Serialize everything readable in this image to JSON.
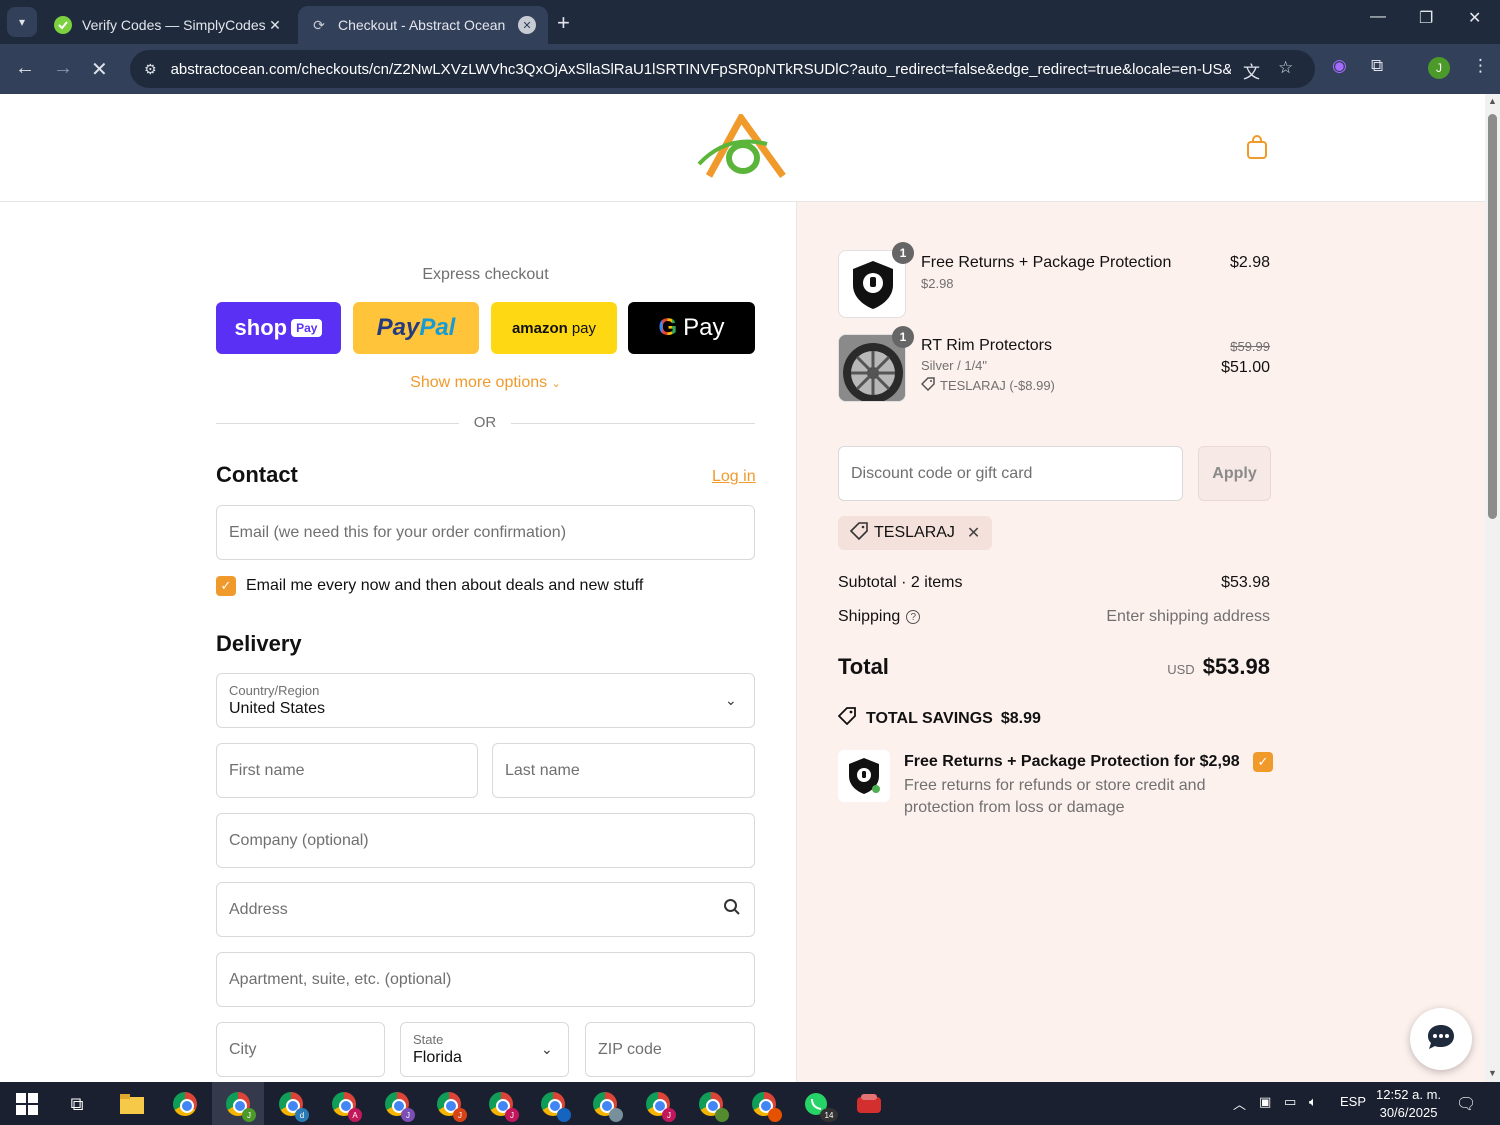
{
  "browser": {
    "tabs": [
      {
        "title": "Verify Codes — SimplyCodes",
        "active": false
      },
      {
        "title": "Checkout - Abstract Ocean",
        "active": true
      }
    ],
    "url": "abstractocean.com/checkouts/cn/Z2NwLXVzLWVhc3QxOjAxSllaSlRaU1lSRTINVFpSR0pNTkRSUDlC?auto_redirect=false&edge_redirect=true&locale=en-US&ski...",
    "profile_initial": "J"
  },
  "checkout": {
    "express_title": "Express checkout",
    "shop_pay": {
      "shop": "shop",
      "pay": "Pay"
    },
    "paypal": {
      "pay": "Pay",
      "pal": "Pal"
    },
    "amazon": {
      "amazon": "amazon",
      "pay": "pay"
    },
    "gpay": {
      "g": "G",
      "pay": "Pay"
    },
    "show_more": "Show more options",
    "or": "OR",
    "contact": {
      "title": "Contact",
      "login": "Log in",
      "email_placeholder": "Email (we need this for your order confirmation)",
      "newsletter_label": "Email me every now and then about deals and new stuff",
      "newsletter_checked": true
    },
    "delivery": {
      "title": "Delivery",
      "country_label": "Country/Region",
      "country_value": "United States",
      "first_name": "First name",
      "last_name": "Last name",
      "company": "Company (optional)",
      "address": "Address",
      "apartment": "Apartment, suite, etc. (optional)",
      "city": "City",
      "state_label": "State",
      "state_value": "Florida",
      "zip": "ZIP code"
    }
  },
  "summary": {
    "items": [
      {
        "qty": "1",
        "name": "Free Returns + Package Protection",
        "sub": "$2.98",
        "price": "$2.98"
      },
      {
        "qty": "1",
        "name": "RT Rim Protectors",
        "sub": "Silver / 1/4\"",
        "discount": "TESLARAJ (-$8.99)",
        "original_price": "$59.99",
        "price": "$51.00"
      }
    ],
    "discount_placeholder": "Discount code or gift card",
    "apply": "Apply",
    "applied_code": "TESLARAJ",
    "subtotal_label": "Subtotal · 2 items",
    "subtotal_value": "$53.98",
    "shipping_label": "Shipping",
    "shipping_value": "Enter shipping address",
    "total_label": "Total",
    "total_currency": "USD",
    "total_value": "$53.98",
    "savings_label": "TOTAL SAVINGS",
    "savings_value": "$8.99",
    "protection_title": "Free Returns + Package Protection for $2,98",
    "protection_desc": "Free returns for refunds or store credit and protection from loss or damage",
    "protection_checked": true
  },
  "taskbar": {
    "language": "ESP",
    "time": "12:52 a. m.",
    "date": "30/6/2025",
    "whatsapp_badge": "14",
    "chrome_badges": [
      "J",
      "J",
      "d",
      "A",
      "J",
      "J",
      "J",
      "",
      "J",
      "J",
      "",
      "J"
    ]
  },
  "colors": {
    "accent": "#f19a2c",
    "summary_bg": "#fdf1ee",
    "shop_pay": "#5a31f4",
    "paypal": "#ffc439",
    "amazon": "#ffd814"
  }
}
